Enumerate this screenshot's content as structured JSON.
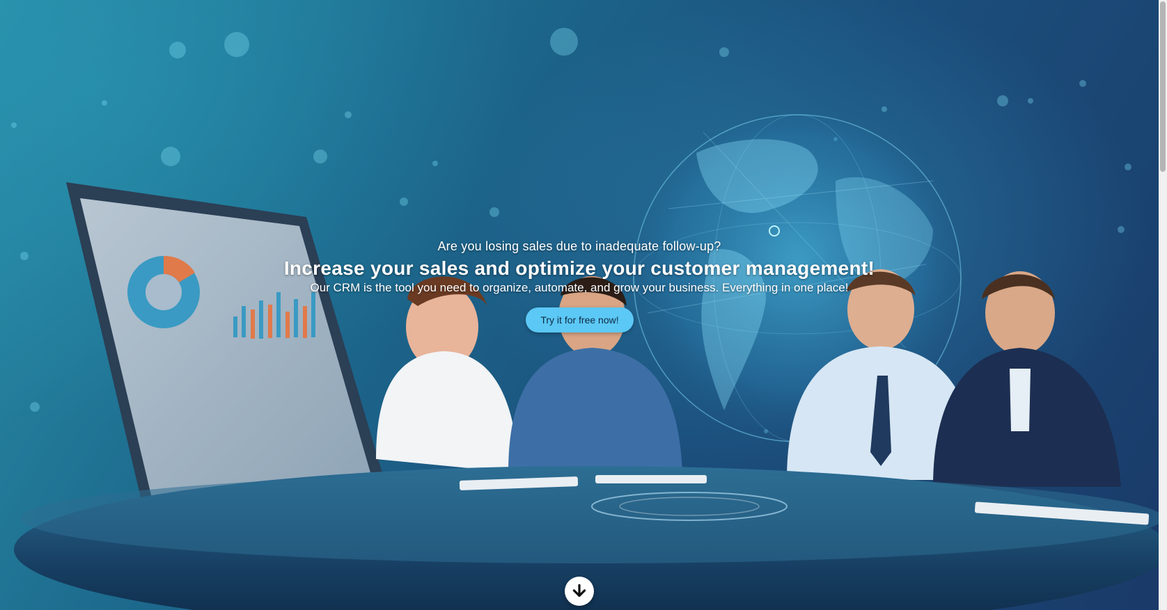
{
  "hero": {
    "eyebrow": "Are you losing sales due to inadequate follow-up?",
    "headline": "Increase your sales and optimize your customer management!",
    "subhead": "Our CRM is the tool you need to organize, automate, and grow your business. Everything in one place!",
    "cta_label": "Try it for free now!",
    "scroll_icon": "arrow-down-icon"
  },
  "colors": {
    "cta_background": "#5cc8f5",
    "cta_text": "#0d2a44",
    "background_start": "#2a8fa8",
    "background_end": "#1a3a69"
  }
}
